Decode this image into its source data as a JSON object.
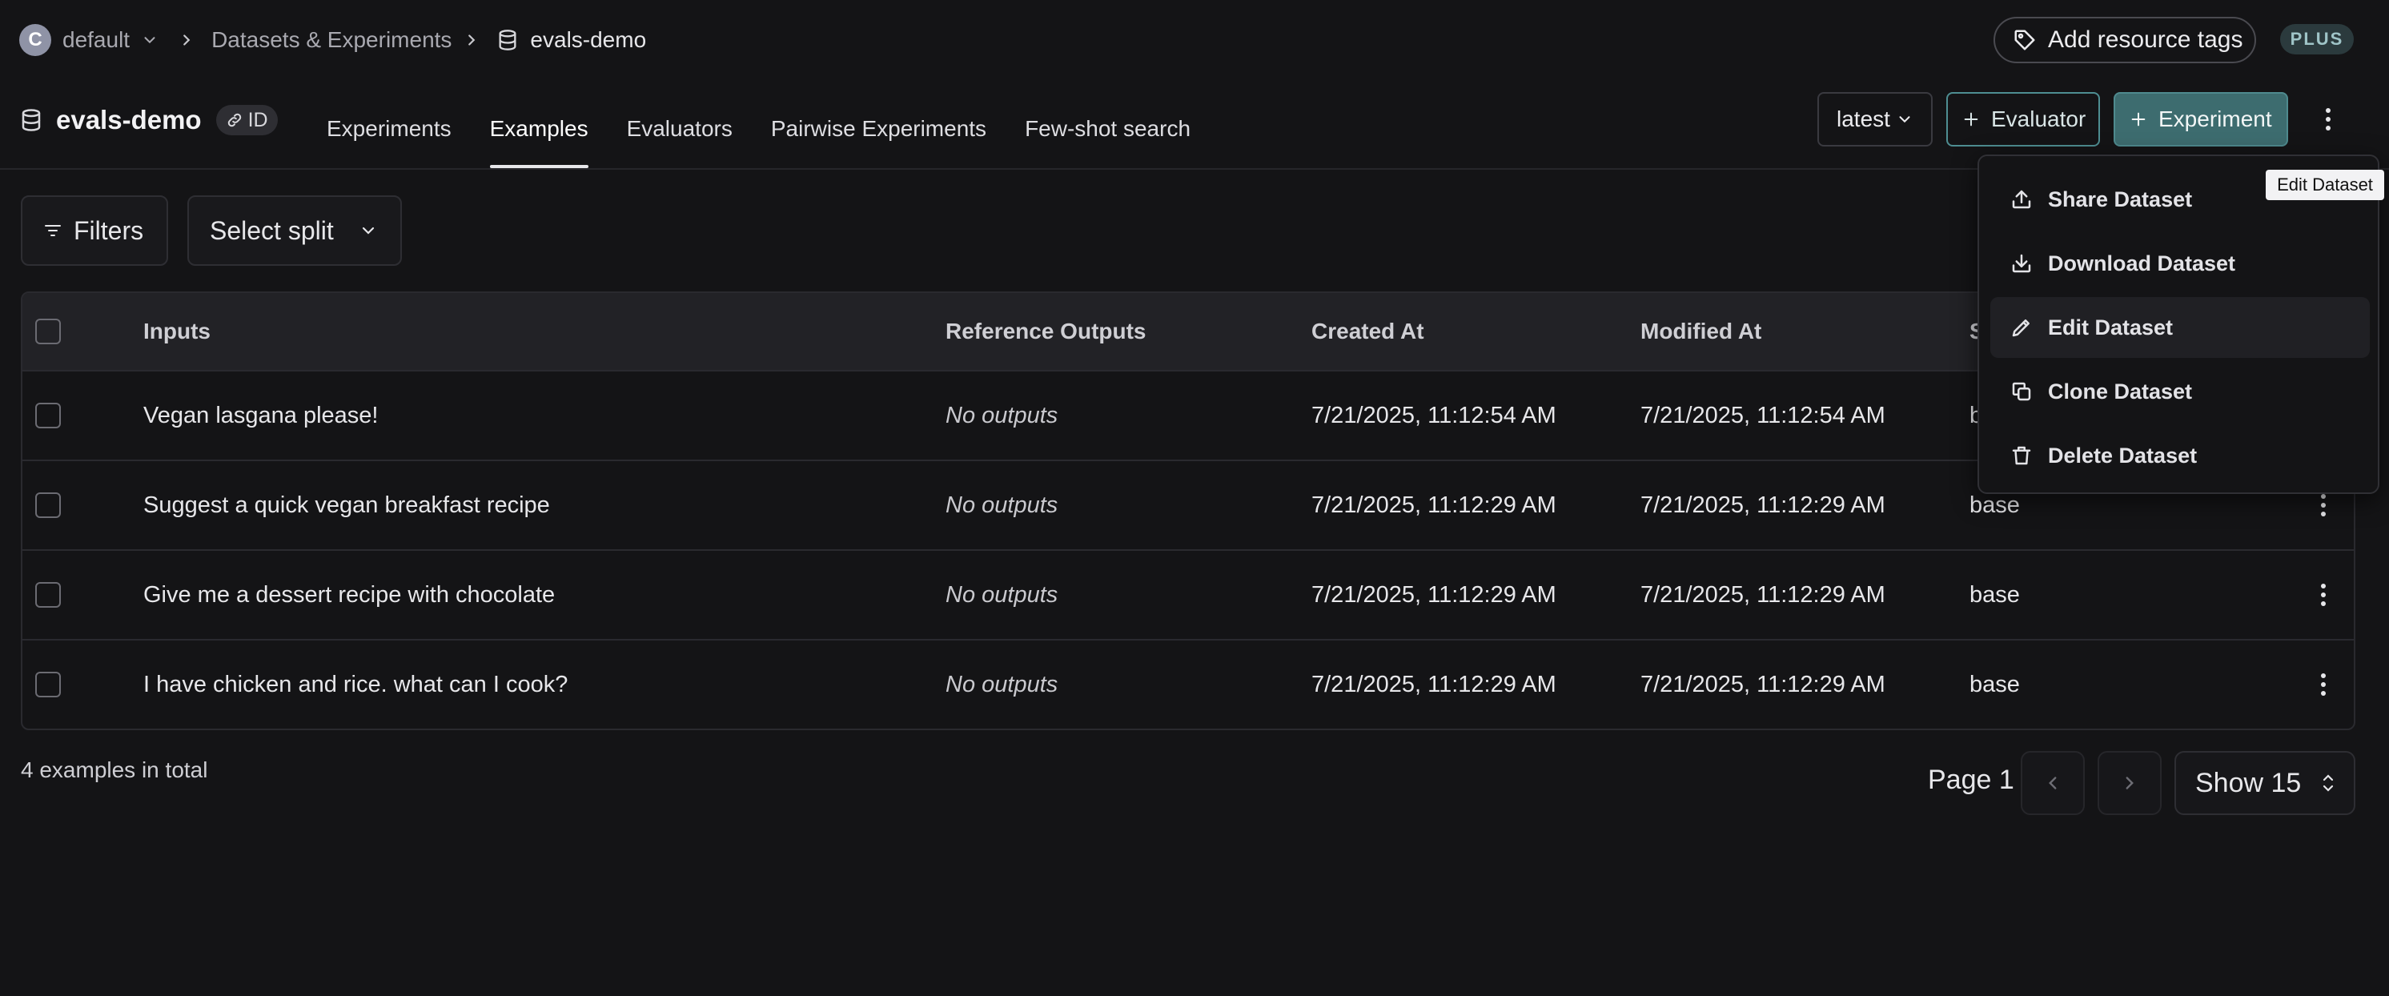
{
  "breadcrumb": {
    "org_initial": "C",
    "org_name": "default",
    "section": "Datasets & Experiments",
    "current": "evals-demo"
  },
  "top_actions": {
    "tags_label": "Add resource tags",
    "plan_badge": "PLUS"
  },
  "dataset": {
    "name": "evals-demo",
    "id_label": "ID"
  },
  "tabs": [
    {
      "label": "Experiments",
      "active": false
    },
    {
      "label": "Examples",
      "active": true
    },
    {
      "label": "Evaluators",
      "active": false
    },
    {
      "label": "Pairwise Experiments",
      "active": false
    },
    {
      "label": "Few-shot search",
      "active": false
    }
  ],
  "header_actions": {
    "version": "latest",
    "evaluator_label": "Evaluator",
    "experiment_label": "Experiment"
  },
  "filters": {
    "filters_label": "Filters",
    "split_placeholder": "Select split"
  },
  "table": {
    "columns": [
      "Inputs",
      "Reference Outputs",
      "Created At",
      "Modified At",
      "S"
    ],
    "rows": [
      {
        "input": "Vegan lasgana please!",
        "outputs": "No outputs",
        "created": "7/21/2025, 11:12:54 AM",
        "modified": "7/21/2025, 11:12:54 AM",
        "split": "b"
      },
      {
        "input": "Suggest a quick vegan breakfast recipe",
        "outputs": "No outputs",
        "created": "7/21/2025, 11:12:29 AM",
        "modified": "7/21/2025, 11:12:29 AM",
        "split": "base"
      },
      {
        "input": "Give me a dessert recipe with chocolate",
        "outputs": "No outputs",
        "created": "7/21/2025, 11:12:29 AM",
        "modified": "7/21/2025, 11:12:29 AM",
        "split": "base"
      },
      {
        "input": "I have chicken and rice. what can I cook?",
        "outputs": "No outputs",
        "created": "7/21/2025, 11:12:29 AM",
        "modified": "7/21/2025, 11:12:29 AM",
        "split": "base"
      }
    ]
  },
  "footer": {
    "total": "4 examples in total",
    "page": "Page 1",
    "show": "Show 15"
  },
  "menu": {
    "items": [
      {
        "label": "Share Dataset",
        "icon": "upload-icon"
      },
      {
        "label": "Download Dataset",
        "icon": "download-icon"
      },
      {
        "label": "Edit Dataset",
        "icon": "pencil-icon"
      },
      {
        "label": "Clone Dataset",
        "icon": "copy-icon"
      },
      {
        "label": "Delete Dataset",
        "icon": "trash-icon"
      }
    ],
    "tooltip": "Edit Dataset"
  },
  "colors": {
    "background": "#141416",
    "accent": "#3d6c6f",
    "accent_border": "#4e8e92"
  }
}
